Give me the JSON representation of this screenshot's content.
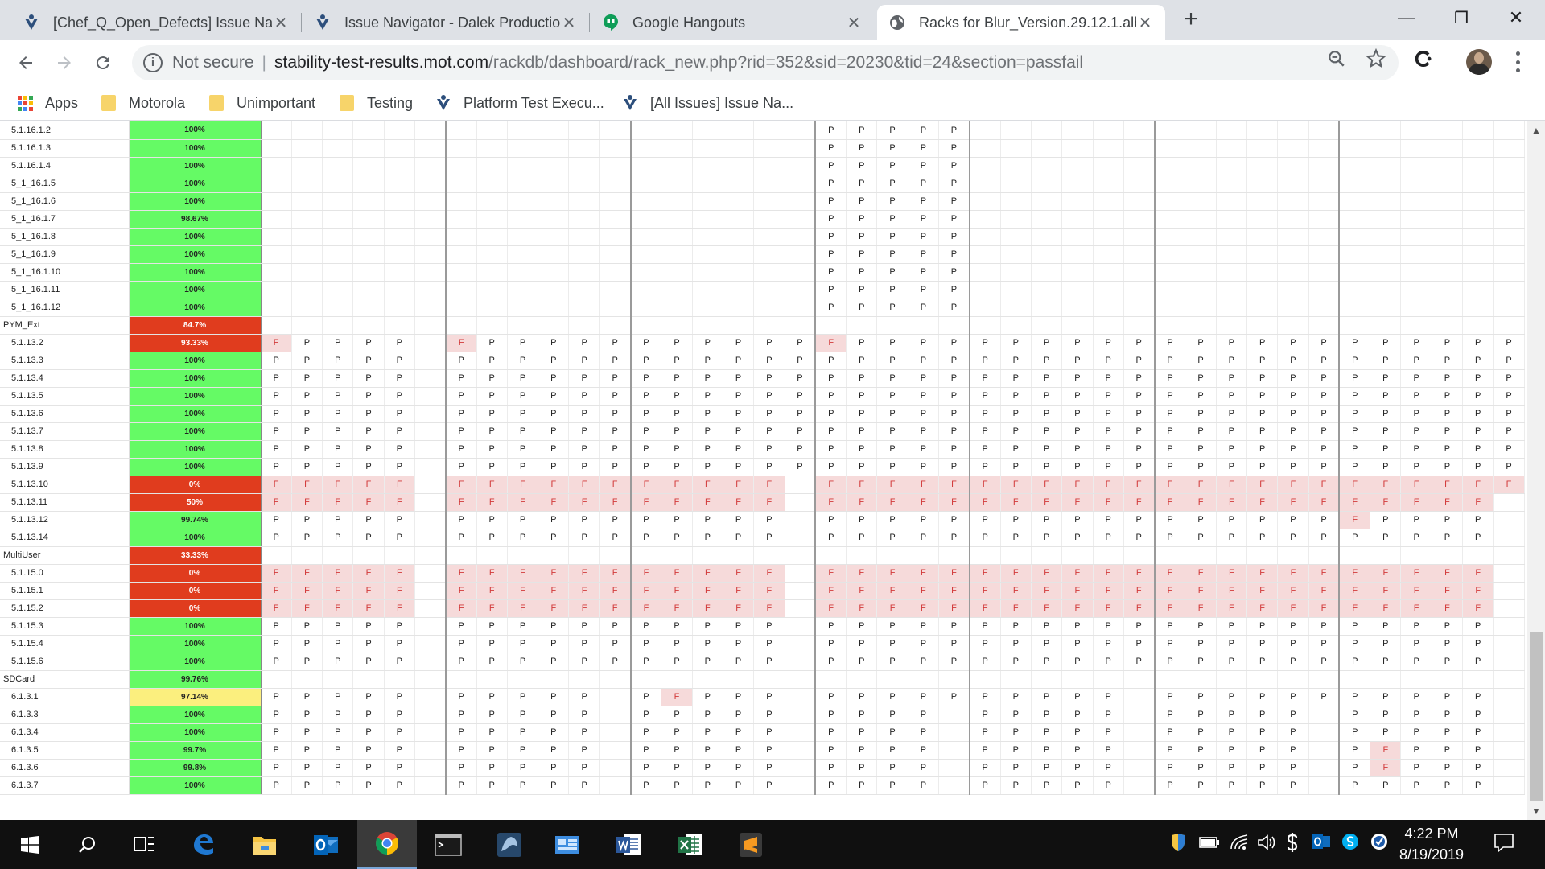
{
  "browser": {
    "tabs": [
      {
        "title": "[Chef_Q_Open_Defects] Issue Na",
        "icon": "jira-icon",
        "active": false
      },
      {
        "title": "Issue Navigator - Dalek Productio",
        "icon": "jira-icon",
        "active": false
      },
      {
        "title": "Google Hangouts",
        "icon": "hangouts-icon",
        "active": false
      },
      {
        "title": "Racks for Blur_Version.29.12.1.alb",
        "icon": "globe-icon",
        "active": true
      }
    ],
    "new_tab_label": "+",
    "window_controls": {
      "minimize": "—",
      "restore": "❐",
      "close": "✕"
    },
    "omnibox": {
      "security_label": "Not secure",
      "host": "stability-test-results.mot.com",
      "path": "/rackdb/dashboard/rack_new.php?rid=352&sid=20230&tid=24&section=passfail"
    },
    "bookmarks": [
      {
        "label": "Apps",
        "icon": "apps-icon"
      },
      {
        "label": "Motorola",
        "icon": "folder-icon"
      },
      {
        "label": "Unimportant",
        "icon": "folder-icon"
      },
      {
        "label": "Testing",
        "icon": "folder-icon"
      },
      {
        "label": "Platform Test Execu...",
        "icon": "jira-icon"
      },
      {
        "label": "[All Issues] Issue Na...",
        "icon": "jira-icon"
      }
    ]
  },
  "report": {
    "rows": [
      {
        "name": "5.1.16.1.2",
        "pct": "100%",
        "status": "green",
        "pattern": "d1"
      },
      {
        "name": "5.1.16.1.3",
        "pct": "100%",
        "status": "green",
        "pattern": "d1"
      },
      {
        "name": "5.1.16.1.4",
        "pct": "100%",
        "status": "green",
        "pattern": "d1"
      },
      {
        "name": "5_1_16.1.5",
        "pct": "100%",
        "status": "green",
        "pattern": "d1"
      },
      {
        "name": "5_1_16.1.6",
        "pct": "100%",
        "status": "green",
        "pattern": "d1"
      },
      {
        "name": "5_1_16.1.7",
        "pct": "98.67%",
        "status": "green",
        "pattern": "d1"
      },
      {
        "name": "5_1_16.1.8",
        "pct": "100%",
        "status": "green",
        "pattern": "d1"
      },
      {
        "name": "5_1_16.1.9",
        "pct": "100%",
        "status": "green",
        "pattern": "d1"
      },
      {
        "name": "5_1_16.1.10",
        "pct": "100%",
        "status": "green",
        "pattern": "d1"
      },
      {
        "name": "5_1_16.1.11",
        "pct": "100%",
        "status": "green",
        "pattern": "d1"
      },
      {
        "name": "5_1_16.1.12",
        "pct": "100%",
        "status": "green",
        "pattern": "d1"
      },
      {
        "name": "PYM_Ext",
        "pct": "84.7%",
        "status": "red",
        "pattern": "group"
      },
      {
        "name": "5.1.13.2",
        "pct": "93.33%",
        "status": "red",
        "pattern": "full",
        "fails": [
          0,
          6,
          18
        ]
      },
      {
        "name": "5.1.13.3",
        "pct": "100%",
        "status": "green",
        "pattern": "full"
      },
      {
        "name": "5.1.13.4",
        "pct": "100%",
        "status": "green",
        "pattern": "full"
      },
      {
        "name": "5.1.13.5",
        "pct": "100%",
        "status": "green",
        "pattern": "full"
      },
      {
        "name": "5.1.13.6",
        "pct": "100%",
        "status": "green",
        "pattern": "full"
      },
      {
        "name": "5.1.13.7",
        "pct": "100%",
        "status": "green",
        "pattern": "full"
      },
      {
        "name": "5.1.13.8",
        "pct": "100%",
        "status": "green",
        "pattern": "full"
      },
      {
        "name": "5.1.13.9",
        "pct": "100%",
        "status": "green",
        "pattern": "full"
      },
      {
        "name": "5.1.13.10",
        "pct": "0%",
        "status": "red",
        "pattern": "allfail_a"
      },
      {
        "name": "5.1.13.11",
        "pct": "50%",
        "status": "red",
        "pattern": "allfail_b"
      },
      {
        "name": "5.1.13.12",
        "pct": "99.74%",
        "status": "green",
        "pattern": "std",
        "fails": [
          35
        ]
      },
      {
        "name": "5.1.13.14",
        "pct": "100%",
        "status": "green",
        "pattern": "std"
      },
      {
        "name": "MultiUser",
        "pct": "33.33%",
        "status": "red",
        "pattern": "group"
      },
      {
        "name": "5.1.15.0",
        "pct": "0%",
        "status": "red",
        "pattern": "allfail_b"
      },
      {
        "name": "5.1.15.1",
        "pct": "0%",
        "status": "red",
        "pattern": "allfail_b"
      },
      {
        "name": "5.1.15.2",
        "pct": "0%",
        "status": "red",
        "pattern": "allfail_b"
      },
      {
        "name": "5.1.15.3",
        "pct": "100%",
        "status": "green",
        "pattern": "std"
      },
      {
        "name": "5.1.15.4",
        "pct": "100%",
        "status": "green",
        "pattern": "std"
      },
      {
        "name": "5.1.15.6",
        "pct": "100%",
        "status": "green",
        "pattern": "std"
      },
      {
        "name": "SDCard",
        "pct": "99.76%",
        "status": "green",
        "pattern": "group"
      },
      {
        "name": "6.1.3.1",
        "pct": "97.14%",
        "status": "yellow",
        "pattern": "sd1",
        "fails": [
          13
        ]
      },
      {
        "name": "6.1.3.3",
        "pct": "100%",
        "status": "green",
        "pattern": "sd"
      },
      {
        "name": "6.1.3.4",
        "pct": "100%",
        "status": "green",
        "pattern": "sd"
      },
      {
        "name": "6.1.3.5",
        "pct": "99.7%",
        "status": "green",
        "pattern": "sd",
        "fails": [
          36
        ]
      },
      {
        "name": "6.1.3.6",
        "pct": "99.8%",
        "status": "green",
        "pattern": "sd",
        "fails": [
          36
        ]
      },
      {
        "name": "6.1.3.7",
        "pct": "100%",
        "status": "green",
        "pattern": "sd"
      }
    ],
    "cell_pass": "P",
    "cell_fail": "F"
  },
  "taskbar": {
    "apps": [
      "start-icon",
      "search-icon",
      "task-view-icon",
      "edge-icon",
      "file-explorer-icon",
      "outlook-icon",
      "chrome-icon",
      "terminal-icon",
      "dbeaver-icon",
      "control-panel-icon",
      "word-icon",
      "excel-icon",
      "sublime-icon"
    ],
    "clock_time": "4:22 PM",
    "clock_date": "8/19/2019"
  },
  "colors": {
    "pass_green": "#65fa65",
    "fail_red": "#e03c1e",
    "warn_yellow": "#fbef7e",
    "fail_cell": "#f6dada"
  }
}
